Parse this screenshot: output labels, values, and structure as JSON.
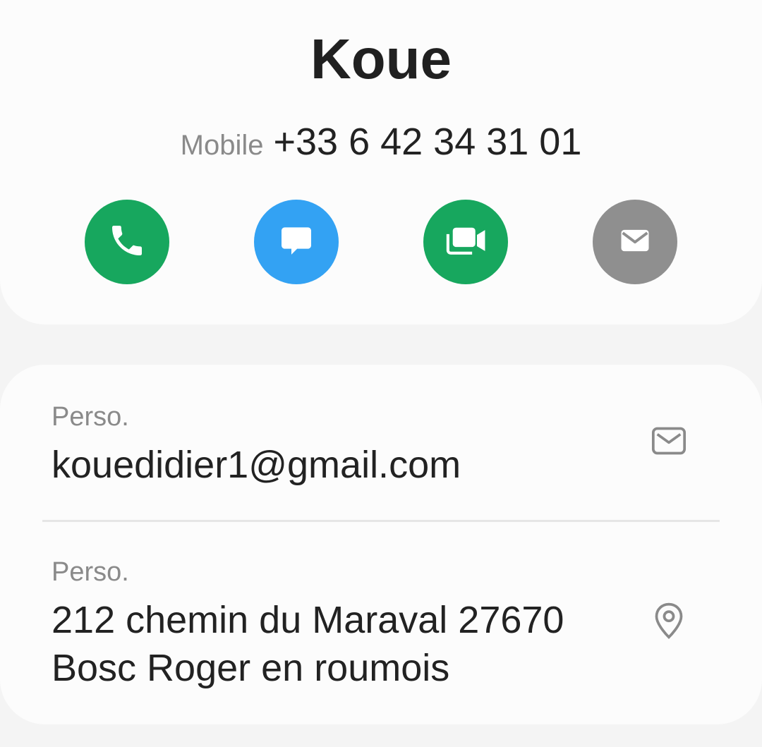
{
  "contact": {
    "name": "Koue",
    "phone_type": "Mobile",
    "phone_number": "+33 6 42 34 31 01"
  },
  "actions": [
    {
      "id": "call",
      "icon": "phone-icon",
      "color": "#17a75e"
    },
    {
      "id": "message",
      "icon": "message-icon",
      "color": "#33a2f3"
    },
    {
      "id": "video-call",
      "icon": "video-icon",
      "color": "#17a75e"
    },
    {
      "id": "email",
      "icon": "mail-icon",
      "color": "#8f8f8f"
    }
  ],
  "details": {
    "email": {
      "label": "Perso.",
      "value": "kouedidier1@gmail.com",
      "icon": "mail-outline-icon"
    },
    "address": {
      "label": "Perso.",
      "line1": "212 chemin du Maraval 27670",
      "line2": "Bosc Roger en roumois",
      "icon": "location-pin-icon"
    }
  }
}
